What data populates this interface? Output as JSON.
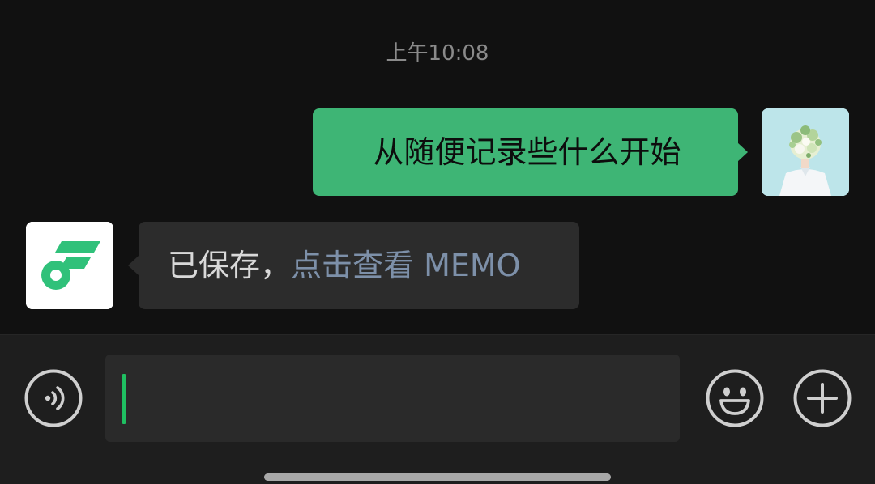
{
  "chat": {
    "timestamp": "上午10:08",
    "messages": [
      {
        "direction": "outgoing",
        "text": "从随便记录些什么开始"
      },
      {
        "direction": "incoming",
        "text_plain": "已保存，",
        "text_link": "点击查看 MEMO"
      }
    ],
    "user_avatar": "user-avatar-illustration",
    "bot_avatar": "flomo-logo"
  },
  "input_bar": {
    "value": "",
    "placeholder": "",
    "voice_icon": "voice-icon",
    "emoji_icon": "emoji-icon",
    "plus_icon": "plus-icon"
  },
  "colors": {
    "background": "#111111",
    "outgoing_bubble": "#3eb575",
    "incoming_bubble": "#2c2c2c",
    "link_text": "#7d90a9",
    "caret": "#1fbf61",
    "brand_green": "#30c17a"
  }
}
